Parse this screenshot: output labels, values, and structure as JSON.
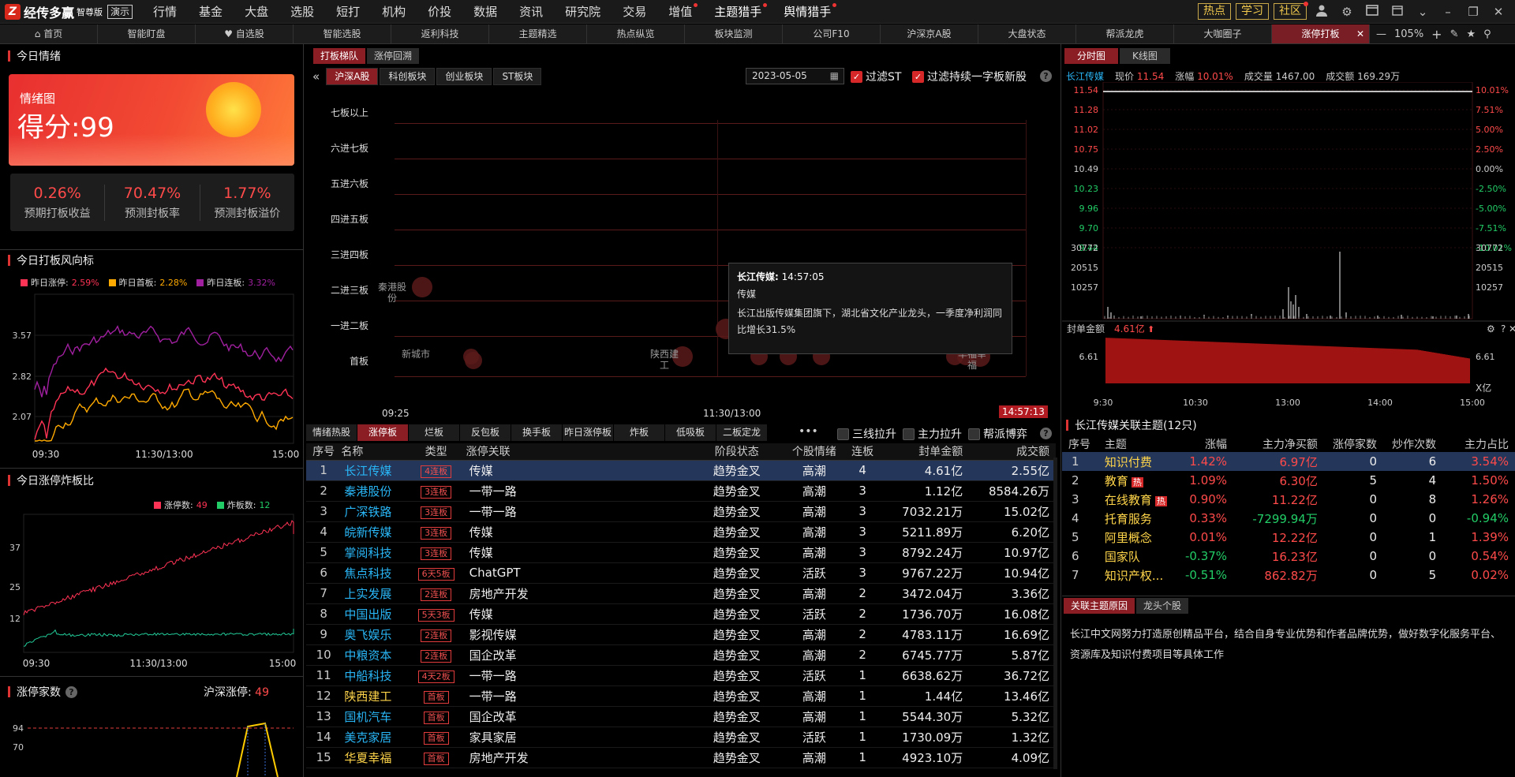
{
  "app": {
    "name": "经传多赢",
    "edition": "智尊版",
    "demo": "演示"
  },
  "menus": [
    {
      "label": "行情"
    },
    {
      "label": "基金"
    },
    {
      "label": "大盘"
    },
    {
      "label": "选股"
    },
    {
      "label": "短打"
    },
    {
      "label": "机构"
    },
    {
      "label": "价投"
    },
    {
      "label": "数据"
    },
    {
      "label": "资讯"
    },
    {
      "label": "研究院"
    },
    {
      "label": "交易"
    },
    {
      "label": "增值",
      "dot": true
    },
    {
      "label": "主题猎手",
      "dot": true,
      "hl": true
    },
    {
      "label": "舆情猎手",
      "dot": true,
      "hl": true
    }
  ],
  "right_buttons": {
    "hot": "热点",
    "learn": "学习",
    "community": "社区"
  },
  "tabs": [
    {
      "label": "首页",
      "icon": "home-icon"
    },
    {
      "label": "智能盯盘"
    },
    {
      "label": "自选股",
      "icon": "heart-icon"
    },
    {
      "label": "智能选股"
    },
    {
      "label": "返利科技"
    },
    {
      "label": "主题精选"
    },
    {
      "label": "热点纵览"
    },
    {
      "label": "板块监测"
    },
    {
      "label": "公司F10"
    },
    {
      "label": "沪深京A股"
    },
    {
      "label": "大盘状态"
    },
    {
      "label": "帮派龙虎"
    },
    {
      "label": "大咖圈子"
    },
    {
      "label": "涨停打板",
      "active": true
    }
  ],
  "zoom": "105%",
  "left": {
    "sentiment_title": "今日情绪",
    "card_label": "情绪图",
    "score_text": "得分:99",
    "stats": [
      {
        "value": "0.26%",
        "label": "预期打板收益"
      },
      {
        "value": "70.47%",
        "label": "预测封板率"
      },
      {
        "value": "1.77%",
        "label": "预测封板溢价"
      }
    ],
    "risk_title": "今日打板风向标",
    "risk_legend": [
      {
        "name": "昨日涨停:",
        "value": "2.59%",
        "color": "#ff3355"
      },
      {
        "name": "昨日首板:",
        "value": "2.28%",
        "color": "#ffaa00"
      },
      {
        "name": "昨日连板:",
        "value": "3.32%",
        "color": "#a020a0"
      }
    ],
    "risk_y": [
      "3.57",
      "2.82",
      "2.07"
    ],
    "risk_x": [
      "09:30",
      "11:30/13:00",
      "15:00"
    ],
    "limit_title": "今日涨停炸板比",
    "limit_legend": [
      {
        "name": "涨停数:",
        "value": "49",
        "color": "#ff3355"
      },
      {
        "name": "炸板数:",
        "value": "12",
        "color": "#22cc66"
      }
    ],
    "limit_y": [
      "37",
      "25",
      "12"
    ],
    "limit_x": [
      "09:30",
      "11:30/13:00",
      "15:00"
    ],
    "count_title": "涨停家数",
    "count_market": "沪深涨停:",
    "count_value": "49",
    "count_y": [
      "94",
      "70"
    ]
  },
  "mid": {
    "top_tabs": [
      {
        "label": "打板梯队",
        "on": true
      },
      {
        "label": "涨停回溯"
      }
    ],
    "board_tabs": [
      {
        "label": "沪深A股",
        "on": true
      },
      {
        "label": "科创板块"
      },
      {
        "label": "创业板块"
      },
      {
        "label": "ST板块"
      }
    ],
    "date": "2023-05-05",
    "filter_st": "过滤ST",
    "filter_one": "过滤持续一字板新股",
    "ladder_rows": [
      "七板以上",
      "六进七板",
      "五进六板",
      "四进五板",
      "三进四板",
      "二进三板",
      "一进二板",
      "首板"
    ],
    "ladder_x": [
      "09:25",
      "11:30/13:00"
    ],
    "bubble_labels": [
      {
        "text": "秦港股份"
      },
      {
        "text": "新城市"
      },
      {
        "text": "陕西建工"
      },
      {
        "text": "长江传媒"
      },
      {
        "text": "华福幸福"
      }
    ],
    "time_badge": "14:57:13",
    "tooltip": {
      "name": "长江传媒:",
      "time": "14:57:05",
      "concept": "传媒",
      "desc": "长江出版传媒集团旗下，湖北省文化产业龙头，一季度净利润同比增长31.5%"
    },
    "table_tabs": [
      {
        "label": "情绪热股"
      },
      {
        "label": "涨停板",
        "on": true
      },
      {
        "label": "烂板"
      },
      {
        "label": "反包板"
      },
      {
        "label": "换手板"
      },
      {
        "label": "昨日涨停板"
      },
      {
        "label": "炸板"
      },
      {
        "label": "低吸板"
      },
      {
        "label": "二板定龙"
      }
    ],
    "table_filters": [
      {
        "label": "三线拉升"
      },
      {
        "label": "主力拉升"
      },
      {
        "label": "帮派博弈"
      }
    ],
    "table_headers": [
      "序号",
      "名称",
      "类型",
      "涨停关联",
      "阶段状态",
      "个股情绪",
      "连板",
      "封单金额",
      "成交额"
    ],
    "rows": [
      {
        "no": "1",
        "name": "长江传媒",
        "type": "4连板",
        "rel": "传媒",
        "stage": "趋势金叉",
        "mood": "高潮",
        "lb": "4",
        "seal": "4.61亿",
        "amt": "2.55亿",
        "sel": true
      },
      {
        "no": "2",
        "name": "秦港股份",
        "type": "3连板",
        "rel": "一带一路",
        "stage": "趋势金叉",
        "mood": "高潮",
        "lb": "3",
        "seal": "1.12亿",
        "amt": "8584.26万"
      },
      {
        "no": "3",
        "name": "广深铁路",
        "type": "3连板",
        "rel": "一带一路",
        "stage": "趋势金叉",
        "mood": "高潮",
        "lb": "3",
        "seal": "7032.21万",
        "amt": "15.02亿"
      },
      {
        "no": "4",
        "name": "皖新传媒",
        "type": "3连板",
        "rel": "传媒",
        "stage": "趋势金叉",
        "mood": "高潮",
        "lb": "3",
        "seal": "5211.89万",
        "amt": "6.20亿"
      },
      {
        "no": "5",
        "name": "掌阅科技",
        "type": "3连板",
        "rel": "传媒",
        "stage": "趋势金叉",
        "mood": "高潮",
        "lb": "3",
        "seal": "8792.24万",
        "amt": "10.97亿"
      },
      {
        "no": "6",
        "name": "焦点科技",
        "type": "6天5板",
        "rel": "ChatGPT",
        "stage": "趋势金叉",
        "mood": "活跃",
        "lb": "3",
        "seal": "9767.22万",
        "amt": "10.94亿"
      },
      {
        "no": "7",
        "name": "上实发展",
        "type": "2连板",
        "rel": "房地产开发",
        "stage": "趋势金叉",
        "mood": "高潮",
        "lb": "2",
        "seal": "3472.04万",
        "amt": "3.36亿"
      },
      {
        "no": "8",
        "name": "中国出版",
        "type": "5天3板",
        "rel": "传媒",
        "stage": "趋势金叉",
        "mood": "活跃",
        "lb": "2",
        "seal": "1736.70万",
        "amt": "16.08亿"
      },
      {
        "no": "9",
        "name": "奥飞娱乐",
        "type": "2连板",
        "rel": "影视传媒",
        "stage": "趋势金叉",
        "mood": "高潮",
        "lb": "2",
        "seal": "4783.11万",
        "amt": "16.69亿"
      },
      {
        "no": "10",
        "name": "中粮资本",
        "type": "2连板",
        "rel": "国企改革",
        "stage": "趋势金叉",
        "mood": "高潮",
        "lb": "2",
        "seal": "6745.77万",
        "amt": "5.87亿"
      },
      {
        "no": "11",
        "name": "中船科技",
        "type": "4天2板",
        "rel": "一带一路",
        "stage": "趋势金叉",
        "mood": "活跃",
        "lb": "1",
        "seal": "6638.62万",
        "amt": "36.72亿"
      },
      {
        "no": "12",
        "name": "陕西建工",
        "type": "首板",
        "rel": "一带一路",
        "stage": "趋势金叉",
        "mood": "高潮",
        "lb": "1",
        "seal": "1.44亿",
        "amt": "13.46亿",
        "yel": true
      },
      {
        "no": "13",
        "name": "国机汽车",
        "type": "首板",
        "rel": "国企改革",
        "stage": "趋势金叉",
        "mood": "高潮",
        "lb": "1",
        "seal": "5544.30万",
        "amt": "5.32亿"
      },
      {
        "no": "14",
        "name": "美克家居",
        "type": "首板",
        "rel": "家具家居",
        "stage": "趋势金叉",
        "mood": "活跃",
        "lb": "1",
        "seal": "1730.09万",
        "amt": "1.32亿"
      },
      {
        "no": "15",
        "name": "华夏幸福",
        "type": "首板",
        "rel": "房地产开发",
        "stage": "趋势金叉",
        "mood": "高潮",
        "lb": "1",
        "seal": "4923.10万",
        "amt": "4.09亿",
        "yel": true
      }
    ]
  },
  "right": {
    "tabs": [
      {
        "label": "分时图",
        "on": true
      },
      {
        "label": "K线图"
      }
    ],
    "quote": {
      "name": "长江传媒",
      "price_label": "现价",
      "price": "11.54",
      "chg_label": "涨幅",
      "chg": "10.01%",
      "vol_label": "成交量",
      "vol": "1467.00",
      "amt_label": "成交额",
      "amt": "169.29万"
    },
    "price_y": [
      "11.54",
      "11.28",
      "11.02",
      "10.75",
      "10.49",
      "10.23",
      "9.96",
      "9.70",
      "9.44"
    ],
    "pct_y": [
      "10.01%",
      "7.51%",
      "5.00%",
      "2.50%",
      "0.00%",
      "-2.50%",
      "-5.00%",
      "-7.51%",
      "-10.01%"
    ],
    "vol_y": [
      "30772",
      "20515",
      "10257"
    ],
    "seal_label": "封单金额",
    "seal_value": "4.61亿",
    "seal_y": "6.61",
    "seal_unit": "X亿",
    "time_x": [
      "9:30",
      "10:30",
      "13:00",
      "14:00",
      "15:00"
    ],
    "rel_title": "长江传媒关联主题(12只)",
    "rel_headers": [
      "序号",
      "主题",
      "涨幅",
      "主力净买额",
      "涨停家数",
      "炒作次数",
      "主力占比"
    ],
    "rel_rows": [
      {
        "no": "1",
        "name": "知识付费",
        "chg": "1.42%",
        "net": "6.97亿",
        "zt": "0",
        "times": "6",
        "pct": "3.54%",
        "sel": true,
        "up": true
      },
      {
        "no": "2",
        "name": "教育",
        "hot": "热",
        "chg": "1.09%",
        "net": "6.30亿",
        "zt": "5",
        "times": "4",
        "pct": "1.50%",
        "up": true
      },
      {
        "no": "3",
        "name": "在线教育",
        "hot": "热",
        "chg": "0.90%",
        "net": "11.22亿",
        "zt": "0",
        "times": "8",
        "pct": "1.26%",
        "up": true
      },
      {
        "no": "4",
        "name": "托育服务",
        "chg": "0.33%",
        "net": "-7299.94万",
        "zt": "0",
        "times": "0",
        "pct": "-0.94%",
        "up": true,
        "netdn": true
      },
      {
        "no": "5",
        "name": "阿里概念",
        "chg": "0.01%",
        "net": "12.22亿",
        "zt": "0",
        "times": "1",
        "pct": "1.39%",
        "up": true
      },
      {
        "no": "6",
        "name": "国家队",
        "chg": "-0.37%",
        "net": "16.23亿",
        "zt": "0",
        "times": "0",
        "pct": "0.54%",
        "up": false
      },
      {
        "no": "7",
        "name": "知识产权...",
        "chg": "-0.51%",
        "net": "862.82万",
        "zt": "0",
        "times": "5",
        "pct": "0.02%",
        "up": false
      }
    ],
    "reason_tabs": [
      {
        "label": "关联主题原因",
        "on": true
      },
      {
        "label": "龙头个股"
      }
    ],
    "reason": "长江中文网努力打造原创精品平台，结合自身专业优势和作者品牌优势，做好数字化服务平台、资源库及知识付费项目等具体工作"
  }
}
